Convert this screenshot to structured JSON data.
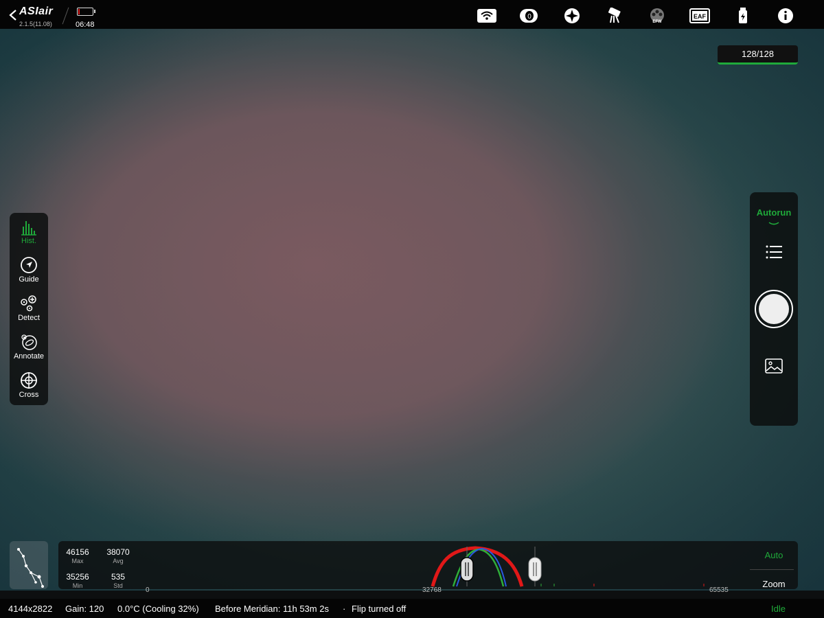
{
  "app": {
    "logo": "ASIair",
    "version": "2.1.5(11.08)",
    "clock": "06:48",
    "battery_level_fraction": 0.1
  },
  "top_icons": [
    {
      "name": "wifi-icon"
    },
    {
      "name": "camera-icon",
      "label": "0"
    },
    {
      "name": "mount-icon"
    },
    {
      "name": "telescope-icon"
    },
    {
      "name": "filter-wheel-icon",
      "label": "EFW"
    },
    {
      "name": "focuser-icon",
      "label": "EAF"
    },
    {
      "name": "usb-power-icon"
    },
    {
      "name": "info-icon"
    }
  ],
  "frame_counter": "128/128",
  "left_tools": [
    {
      "name": "hist",
      "label": "Hist.",
      "active": true
    },
    {
      "name": "guide",
      "label": "Guide",
      "active": false
    },
    {
      "name": "detect",
      "label": "Detect",
      "active": false
    },
    {
      "name": "annotate",
      "label": "Annotate",
      "active": false
    },
    {
      "name": "cross",
      "label": "Cross",
      "active": false
    }
  ],
  "right_panel": {
    "mode": "Autorun",
    "menu_icon": "list-icon",
    "shutter_icon": "shutter-button",
    "gallery_icon": "gallery-icon"
  },
  "histogram": {
    "stats": {
      "max": {
        "value": "46156",
        "label": "Max"
      },
      "avg": {
        "value": "38070",
        "label": "Avg"
      },
      "min": {
        "value": "35256",
        "label": "Min"
      },
      "std": {
        "value": "535",
        "label": "Std"
      }
    },
    "axis": [
      "0",
      "32768",
      "65535"
    ],
    "auto_label": "Auto",
    "zoom_label": "Zoom"
  },
  "status": {
    "resolution": "4144x2822",
    "gain": "Gain: 120",
    "temperature": "0.0°C (Cooling 32%)",
    "meridian": "Before Meridian: 11h 53m 2s",
    "separator": "·",
    "flip": "Flip turned off",
    "state": "Idle"
  },
  "colors": {
    "accent": "#1faa3a",
    "battery_low": "#e02020"
  }
}
